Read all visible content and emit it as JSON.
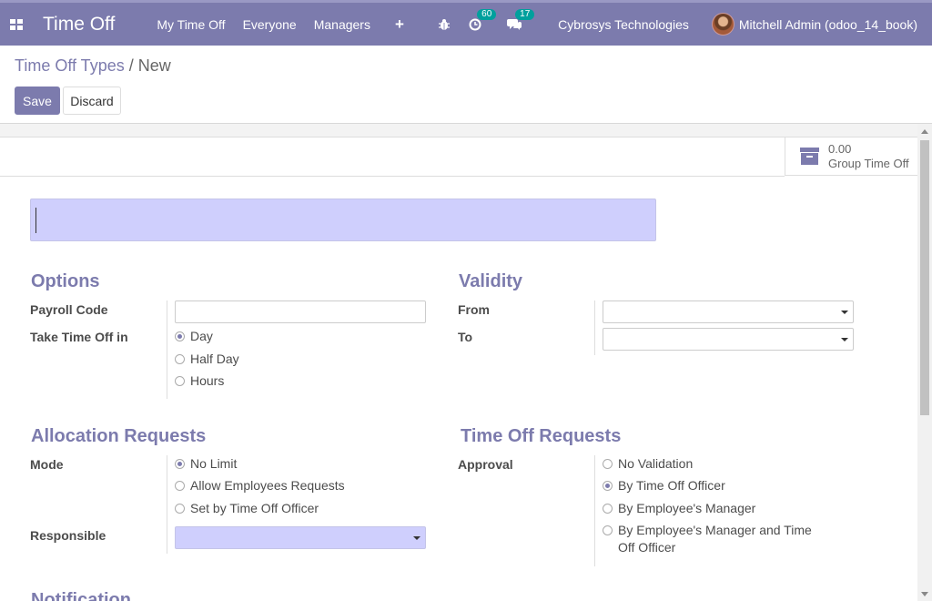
{
  "navbar": {
    "app_title": "Time Off",
    "menu": [
      "My Time Off",
      "Everyone",
      "Managers"
    ],
    "activity_count": "60",
    "messages_count": "17",
    "company": "Cybrosys Technologies",
    "user": "Mitchell Admin (odoo_14_book)"
  },
  "breadcrumb": {
    "parent": "Time Off Types",
    "separator": "/",
    "current": "New"
  },
  "buttons": {
    "save": "Save",
    "discard": "Discard"
  },
  "stat_button": {
    "value": "0.00",
    "label": "Group Time Off"
  },
  "form": {
    "name_value": "",
    "options": {
      "title": "Options",
      "payroll_code_label": "Payroll Code",
      "payroll_code_value": "",
      "take_time_off_label": "Take Time Off in",
      "take_time_off_options": [
        "Day",
        "Half Day",
        "Hours"
      ],
      "take_time_off_selected": "Day"
    },
    "validity": {
      "title": "Validity",
      "from_label": "From",
      "from_value": "",
      "to_label": "To",
      "to_value": ""
    },
    "allocation": {
      "title": "Allocation Requests",
      "mode_label": "Mode",
      "mode_options": [
        "No Limit",
        "Allow Employees Requests",
        "Set by Time Off Officer"
      ],
      "mode_selected": "No Limit",
      "responsible_label": "Responsible",
      "responsible_value": ""
    },
    "time_off_requests": {
      "title": "Time Off Requests",
      "approval_label": "Approval",
      "approval_options": [
        "No Validation",
        "By Time Off Officer",
        "By Employee's Manager",
        "By Employee's Manager and Time Off Officer"
      ],
      "approval_selected": "By Time Off Officer"
    },
    "notification_title": "Notification"
  },
  "colors": {
    "primary": "#7c7bad",
    "required_field": "#cfcffd",
    "badge": "#00a09d"
  }
}
